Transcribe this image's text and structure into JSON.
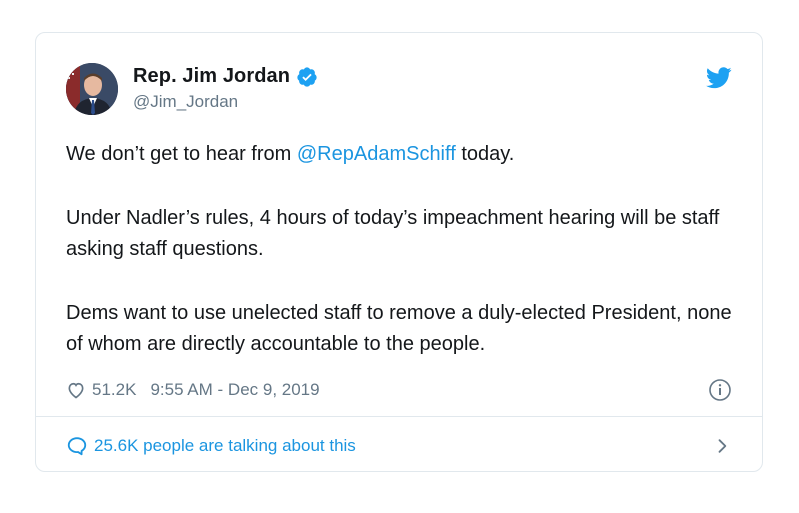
{
  "tweet": {
    "display_name": "Rep. Jim Jordan",
    "handle": "@Jim_Jordan",
    "paragraph1_before": "We don’t get to hear from ",
    "paragraph1_mention": "@RepAdamSchiff",
    "paragraph1_after": " today.",
    "paragraph2": "Under Nadler’s rules, 4 hours of today’s impeachment hearing will be staff asking staff questions.",
    "paragraph3": "Dems want to use unelected staff to remove a duly-elected President, none of whom are directly accountable to the people.",
    "likes": "51.2K",
    "timestamp": "9:55 AM - Dec 9, 2019",
    "talking": "25.6K people are talking about this"
  },
  "icons": {
    "verified": "verified-badge-icon",
    "brand": "twitter-bird-icon",
    "like": "heart-icon",
    "info": "info-icon",
    "reply": "speech-bubble-icon",
    "chevron": "chevron-right-icon"
  },
  "colors": {
    "accent": "#1b95e0",
    "text": "#14171a",
    "secondary": "#657786",
    "border": "#e1e8ed"
  }
}
